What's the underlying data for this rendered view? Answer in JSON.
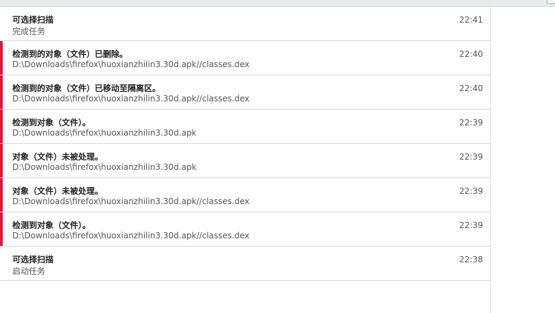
{
  "events": [
    {
      "title": "可选择扫描",
      "detail": "完成任务",
      "time": "22:41",
      "alert": false
    },
    {
      "title": "检测到的对象（文件）已删除。",
      "detail": "D:\\Downloads\\firefox\\huoxianzhilin3.30d.apk//classes.dex",
      "time": "22:40",
      "alert": true
    },
    {
      "title": "检测到的对象（文件）已移动至隔离区。",
      "detail": "D:\\Downloads\\firefox\\huoxianzhilin3.30d.apk//classes.dex",
      "time": "22:40",
      "alert": true
    },
    {
      "title": "检测到对象（文件）。",
      "detail": "D:\\Downloads\\firefox\\huoxianzhilin3.30d.apk",
      "time": "22:39",
      "alert": true
    },
    {
      "title": "对象（文件）未被处理。",
      "detail": "D:\\Downloads\\firefox\\huoxianzhilin3.30d.apk",
      "time": "22:39",
      "alert": true
    },
    {
      "title": "对象（文件）未被处理。",
      "detail": "D:\\Downloads\\firefox\\huoxianzhilin3.30d.apk//classes.dex",
      "time": "22:39",
      "alert": true
    },
    {
      "title": "检测到对象（文件）。",
      "detail": "D:\\Downloads\\firefox\\huoxianzhilin3.30d.apk//classes.dex",
      "time": "22:39",
      "alert": true
    },
    {
      "title": "可选择扫描",
      "detail": "启动任务",
      "time": "22:38",
      "alert": false
    }
  ],
  "colors": {
    "alert_bar": "#d21f3c",
    "divider": "#d9d9d9",
    "topbar": "#e8ebed"
  }
}
